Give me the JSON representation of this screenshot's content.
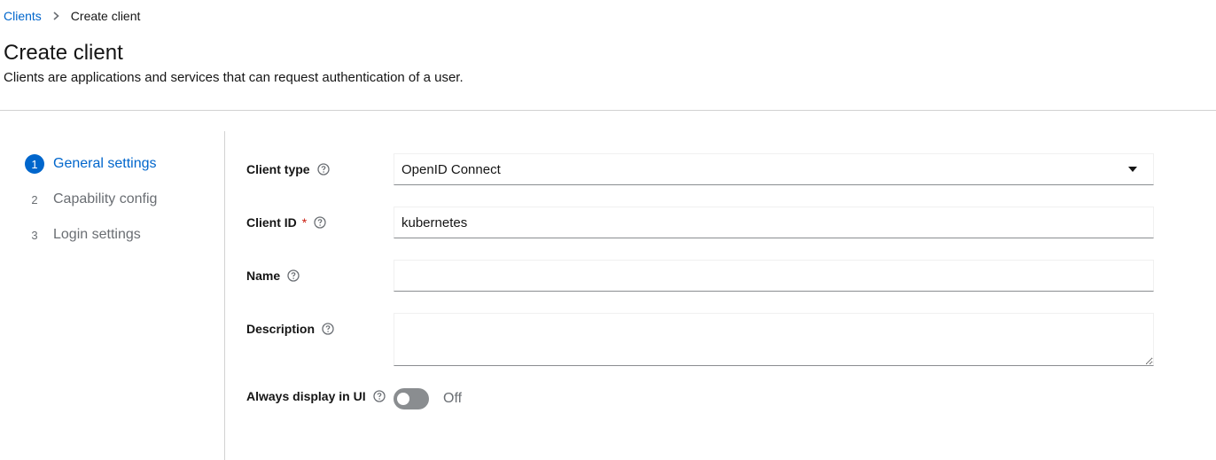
{
  "breadcrumb": {
    "parent": "Clients",
    "current": "Create client"
  },
  "header": {
    "title": "Create client",
    "description": "Clients are applications and services that can request authentication of a user."
  },
  "wizard": {
    "steps": [
      {
        "number": "1",
        "label": "General settings",
        "state": "active"
      },
      {
        "number": "2",
        "label": "Capability config",
        "state": "inactive"
      },
      {
        "number": "3",
        "label": "Login settings",
        "state": "inactive"
      }
    ]
  },
  "form": {
    "client_type": {
      "label": "Client type",
      "value": "OpenID Connect"
    },
    "client_id": {
      "label": "Client ID",
      "required_mark": "*",
      "value": "kubernetes"
    },
    "name": {
      "label": "Name",
      "value": ""
    },
    "description": {
      "label": "Description",
      "value": ""
    },
    "always_display": {
      "label": "Always display in UI",
      "state_label": "Off",
      "enabled": false
    }
  },
  "colors": {
    "accent": "#0066cc",
    "required": "#c9190b",
    "toggle_off": "#8a8d90"
  }
}
